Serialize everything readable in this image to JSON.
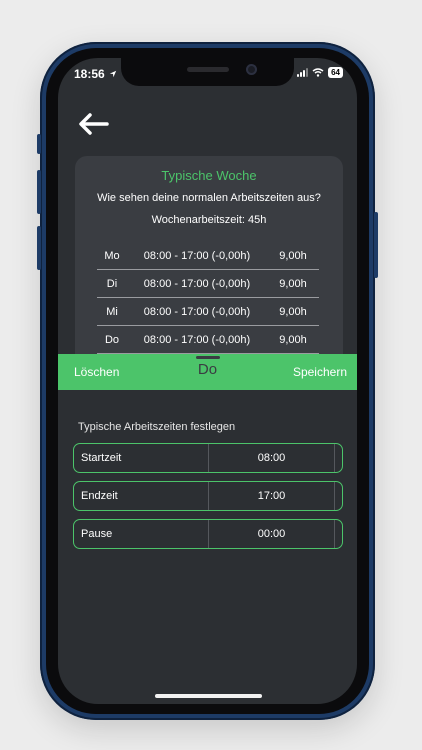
{
  "status": {
    "time": "18:56",
    "battery": "64"
  },
  "card": {
    "title": "Typische Woche",
    "question": "Wie sehen deine normalen Arbeitszeiten aus?",
    "weekly_hours": "Wochenarbeitszeit: 45h",
    "rows": [
      {
        "day": "Mo",
        "time": "08:00 - 17:00 (-0,00h)",
        "hours": "9,00h"
      },
      {
        "day": "Di",
        "time": "08:00 - 17:00 (-0,00h)",
        "hours": "9,00h"
      },
      {
        "day": "Mi",
        "time": "08:00 - 17:00 (-0,00h)",
        "hours": "9,00h"
      },
      {
        "day": "Do",
        "time": "08:00 - 17:00 (-0,00h)",
        "hours": "9,00h"
      }
    ]
  },
  "sheet": {
    "delete_label": "Löschen",
    "day": "Do",
    "save_label": "Speichern",
    "section_label": "Typische Arbeitszeiten festlegen",
    "fields": [
      {
        "label": "Startzeit",
        "value": "08:00"
      },
      {
        "label": "Endzeit",
        "value": "17:00"
      },
      {
        "label": "Pause",
        "value": "00:00"
      }
    ]
  },
  "colors": {
    "accent": "#4cc46a",
    "background": "#2c2f33",
    "card": "#3a3d42",
    "frame": "#1d3b66"
  },
  "icons": {
    "back": "arrow-left-icon",
    "signal": "cellular-signal-icon",
    "wifi": "wifi-icon",
    "battery": "battery-icon",
    "location": "location-icon"
  }
}
